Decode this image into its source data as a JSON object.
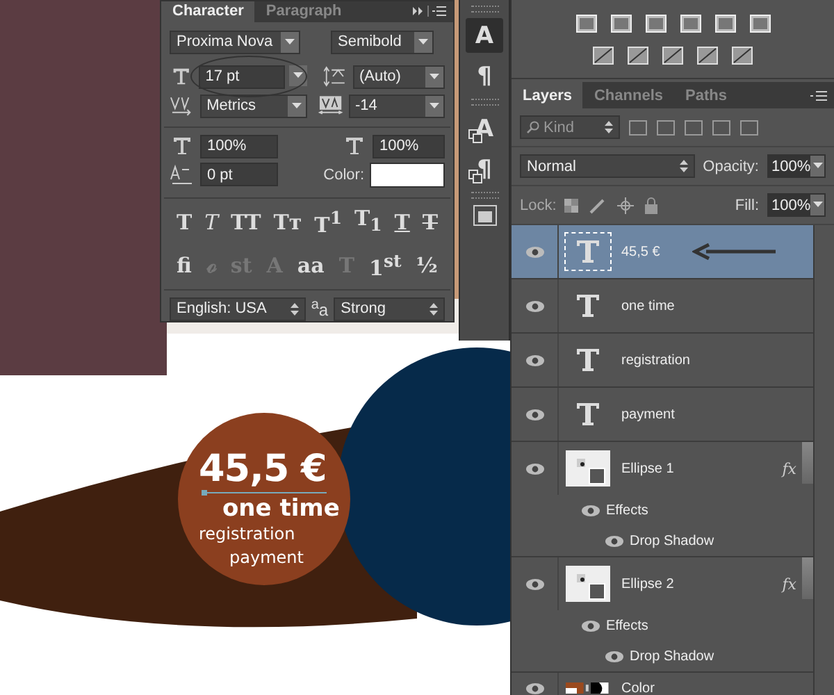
{
  "document": {
    "price": "45,5 €",
    "line_1": "one time",
    "line_2": "registration",
    "line_3": "payment"
  },
  "character_panel": {
    "tabs": [
      {
        "label": "Character",
        "selected": true
      },
      {
        "label": "Paragraph",
        "selected": false
      }
    ],
    "font_family": "Proxima Nova",
    "font_style": "Semibold",
    "font_size": "17 pt",
    "leading": "(Auto)",
    "kerning": "Metrics",
    "tracking": "-14",
    "vertical_scale": "100%",
    "horizontal_scale": "100%",
    "baseline_shift": "0 pt",
    "color_label": "Color:",
    "style_buttons": [
      {
        "label": "T",
        "kind": "bold"
      },
      {
        "label": "T",
        "kind": "italic"
      },
      {
        "label": "TT",
        "kind": "caps"
      },
      {
        "label": "Tᴛ",
        "kind": "smallcaps"
      },
      {
        "label": "T$^{1}$",
        "kind": "super"
      },
      {
        "label": "T$_{1}$",
        "kind": "sub"
      },
      {
        "label": "T",
        "kind": "underline"
      },
      {
        "label": "T",
        "kind": "strike"
      }
    ],
    "opentype_buttons": [
      {
        "label": "fi",
        "disabled": false
      },
      {
        "label": "ℴ",
        "disabled": true
      },
      {
        "label": "st",
        "disabled": true
      },
      {
        "label": "A",
        "disabled": true
      },
      {
        "label": "aa",
        "disabled": false
      },
      {
        "label": "T",
        "disabled": true
      },
      {
        "label": "1$^{st}$",
        "disabled": false
      },
      {
        "label": "½",
        "disabled": false
      }
    ],
    "language": "English: USA",
    "antialias_label": "$^{a}$a",
    "antialias": "Strong"
  },
  "dock": [
    {
      "label": "A",
      "kind": "panel",
      "selected": true
    },
    {
      "label": "¶",
      "kind": "panel",
      "selected": false
    },
    {
      "label": "A",
      "kind": "preset",
      "selected": false
    },
    {
      "label": "¶",
      "kind": "preset",
      "selected": false
    }
  ],
  "layers_panel": {
    "tabs": [
      {
        "label": "Layers",
        "selected": true
      },
      {
        "label": "Channels",
        "selected": false
      },
      {
        "label": "Paths",
        "selected": false
      }
    ],
    "filter_placeholder": "Kind",
    "blend_mode": "Normal",
    "opacity_label": "Opacity:",
    "opacity": "100%",
    "lock_label": "Lock:",
    "fill_label": "Fill:",
    "fill": "100%",
    "layers": [
      {
        "kind": "text",
        "name": "45,5 €",
        "selected": true,
        "visible": true
      },
      {
        "kind": "text",
        "name": "one time",
        "selected": false,
        "visible": true
      },
      {
        "kind": "text",
        "name": "registration",
        "selected": false,
        "visible": true
      },
      {
        "kind": "text",
        "name": "payment",
        "selected": false,
        "visible": true
      },
      {
        "kind": "shape",
        "name": "Ellipse 1",
        "selected": false,
        "visible": true,
        "fx": "fx",
        "effects_label": "Effects",
        "effects": [
          "Drop Shadow"
        ]
      },
      {
        "kind": "shape",
        "name": "Ellipse 2",
        "selected": false,
        "visible": true,
        "fx": "fx",
        "effects_label": "Effects",
        "effects": [
          "Drop Shadow"
        ]
      },
      {
        "kind": "masked",
        "name": "Color",
        "selected": false,
        "visible": true
      }
    ]
  }
}
